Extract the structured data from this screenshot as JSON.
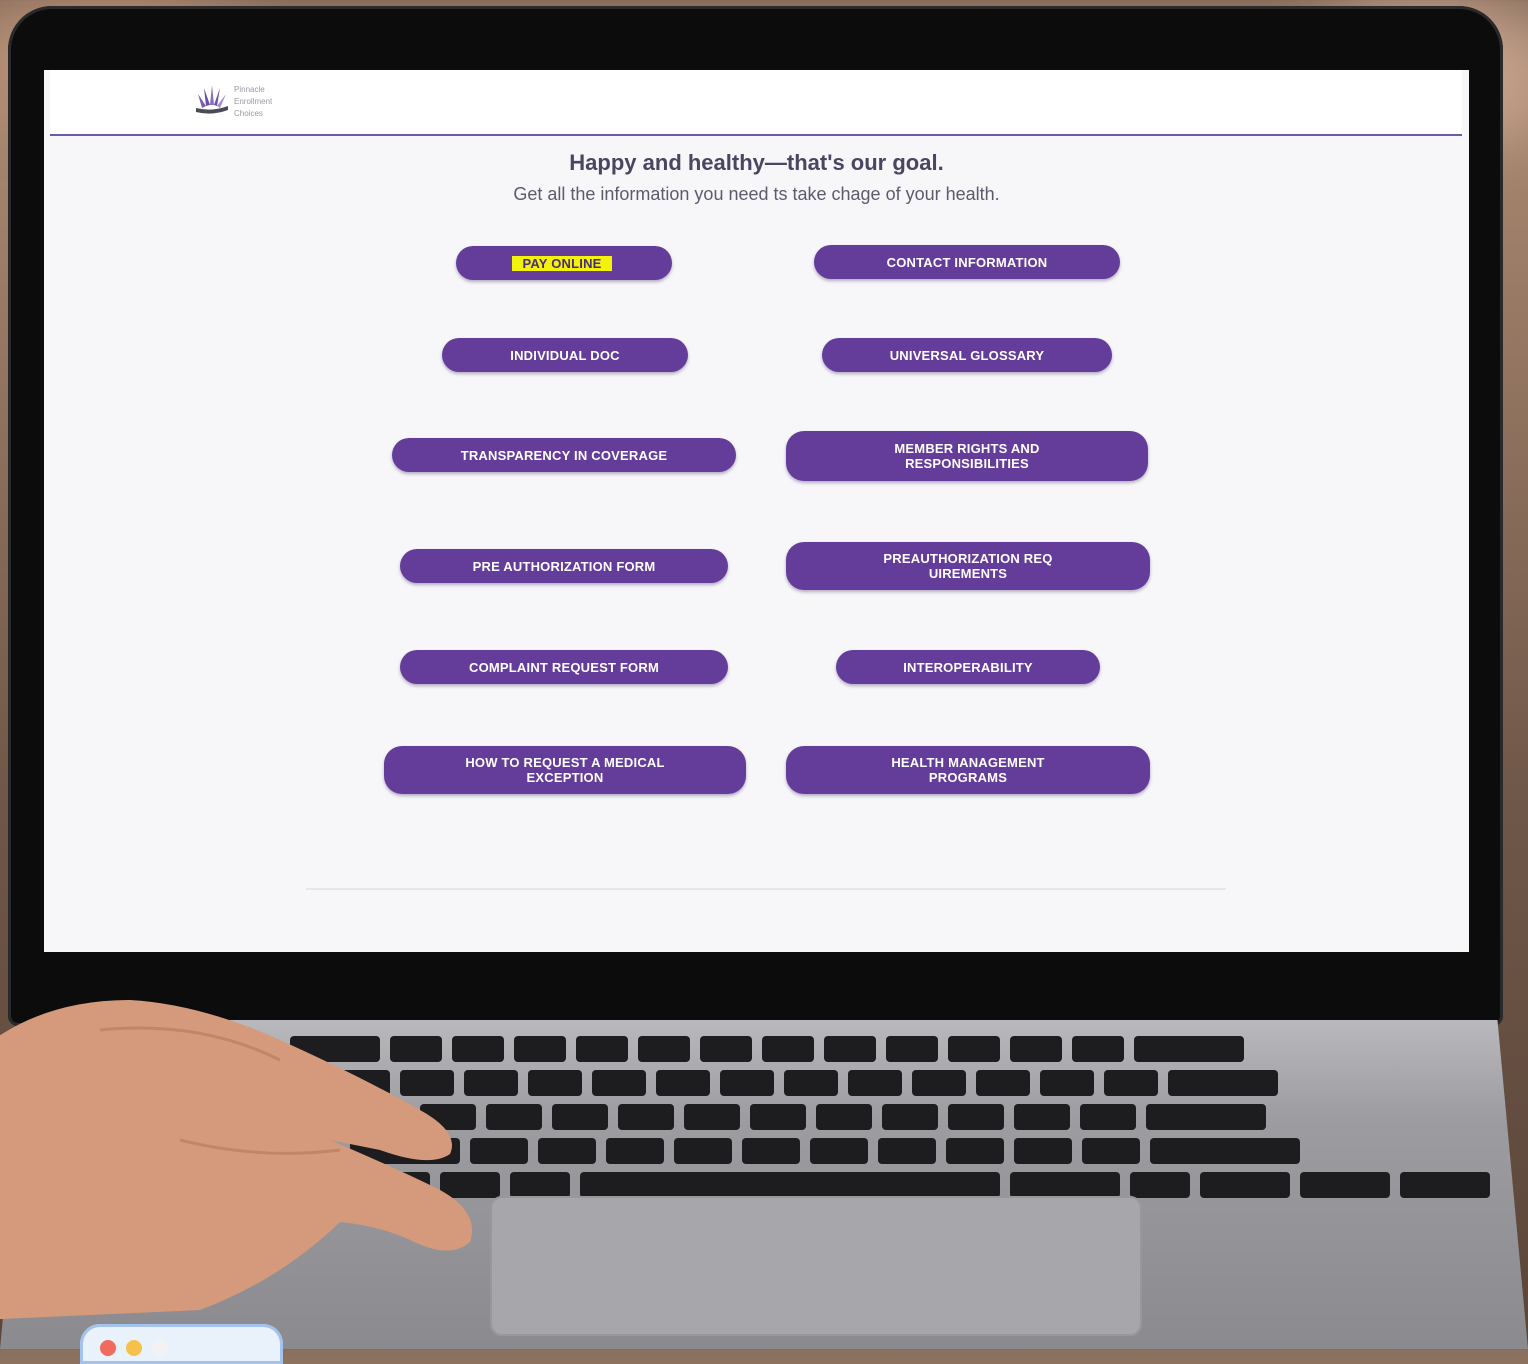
{
  "site": {
    "logo": {
      "lines": [
        "Pinnacle",
        "Enrollment",
        "Choices"
      ],
      "icon": "fan-leaf-logo-icon"
    },
    "hero": {
      "title": "Happy and healthy—that's our goal.",
      "subtitle": "Get all the information you need ts take chage of your health."
    },
    "buttons": [
      {
        "id": "pay-online",
        "label": "PAY ONLINE"
      },
      {
        "id": "contact-information",
        "label": "CONTACT INFORMATION"
      },
      {
        "id": "individual-doc",
        "label": "INDIVIDUAL DOC"
      },
      {
        "id": "universal-glossary",
        "label": "UNIVERSAL GLOSSARY"
      },
      {
        "id": "transparency-in-coverage",
        "label": "TRANSPARENCY IN COVERAGE"
      },
      {
        "id": "member-rights",
        "label": "MEMBER RIGHTS AND RESPONSIBILITIES"
      },
      {
        "id": "pre-authorization-form",
        "label": "PRE AUTHORIZATION FORM"
      },
      {
        "id": "pre-authorization-requirements",
        "label": "PREAUTHORIZATION REQUIREMENTS"
      },
      {
        "id": "complaint-request-form",
        "label": "COMPLAINT REQUEST FORM"
      },
      {
        "id": "interoperability",
        "label": "INTEROPERABILITY"
      },
      {
        "id": "medical-exception",
        "label": "HOW TO REQUEST A MEDICAL EXCEPTION"
      },
      {
        "id": "health-management-programs",
        "label": "HEALTH MANAGEMENT PROGRAMS"
      }
    ]
  },
  "colors": {
    "button_bg": "#643c99",
    "highlight": "#f3f20a",
    "header_rule": "#6e5aa6"
  },
  "dock": {
    "dots": [
      "#f06a5d",
      "#f5c14b",
      "#f2f2f2"
    ]
  }
}
